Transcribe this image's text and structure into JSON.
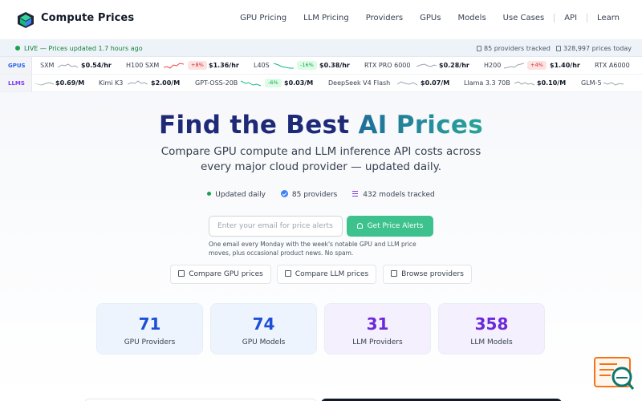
{
  "brand": {
    "name": "Compute Prices"
  },
  "nav": {
    "links": [
      "GPU Pricing",
      "LLM Pricing",
      "Providers",
      "GPUs",
      "Models",
      "Use Cases"
    ],
    "extra": [
      "API",
      "Learn"
    ]
  },
  "status": {
    "live": "LIVE — Prices updated 1.7 hours ago",
    "providers_tracked": "85 providers tracked",
    "prices_today": "328,997 prices today"
  },
  "ticker": {
    "gpus_label": "GPUS",
    "llms_label": "LLMS",
    "gpus": [
      {
        "name": "SXM",
        "price": "$0.54/hr",
        "change": ""
      },
      {
        "name": "H100 SXM",
        "price": "$1.36/hr",
        "change": "+8%"
      },
      {
        "name": "L40S",
        "price": "$0.38/hr",
        "change": "-16%"
      },
      {
        "name": "RTX PRO 6000",
        "price": "$0.28/hr",
        "change": ""
      },
      {
        "name": "H200",
        "price": "$1.40/hr",
        "change": "+4%"
      },
      {
        "name": "RTX A6000",
        "price": "",
        "change": ""
      }
    ],
    "llms": [
      {
        "name": "",
        "price": "$0.69/M",
        "change": ""
      },
      {
        "name": "Kimi K3",
        "price": "$2.00/M",
        "change": ""
      },
      {
        "name": "GPT-OSS-20B",
        "price": "$0.03/M",
        "change": "-6%"
      },
      {
        "name": "DeepSeek V4 Flash",
        "price": "$0.07/M",
        "change": ""
      },
      {
        "name": "Llama 3.3 70B",
        "price": "$0.10/M",
        "change": ""
      },
      {
        "name": "GLM-5",
        "price": "",
        "change": ""
      }
    ]
  },
  "hero": {
    "title_part1": "Find the Best",
    "title_part2": "AI Prices",
    "subtitle": "Compare GPU compute and LLM inference API costs across every major cloud provider — updated daily.",
    "pills": [
      "Updated daily",
      "85 providers",
      "432 models tracked"
    ],
    "email_placeholder": "Enter your email for price alerts",
    "alert_button": "Get Price Alerts",
    "note": "One email every Monday with the week's notable GPU and LLM price moves, plus occasional product news. No spam.",
    "ctas": [
      "Compare GPU prices",
      "Compare LLM prices",
      "Browse providers"
    ]
  },
  "stats": [
    {
      "value": "71",
      "label": "GPU Providers",
      "color": "#1d4ed8"
    },
    {
      "value": "74",
      "label": "GPU Models",
      "color": "#1d4ed8"
    },
    {
      "value": "31",
      "label": "LLM Providers",
      "color": "#6d28d9"
    },
    {
      "value": "358",
      "label": "LLM Models",
      "color": "#6d28d9"
    }
  ],
  "colors": {
    "accent_green": "#3ec28d",
    "live_green": "#16a34a",
    "title_navy": "#1e2a78",
    "title_teal": "#2aa39a",
    "increase_red": "#dc2626",
    "decrease_green": "#16a34a"
  },
  "icons": [
    "logo-icon",
    "live-dot-icon",
    "server-icon",
    "price-tag-icon",
    "check-badge-icon",
    "list-icon",
    "bell-icon",
    "table-icon",
    "terminal-icon",
    "building-icon",
    "search-feedback-icon"
  ]
}
